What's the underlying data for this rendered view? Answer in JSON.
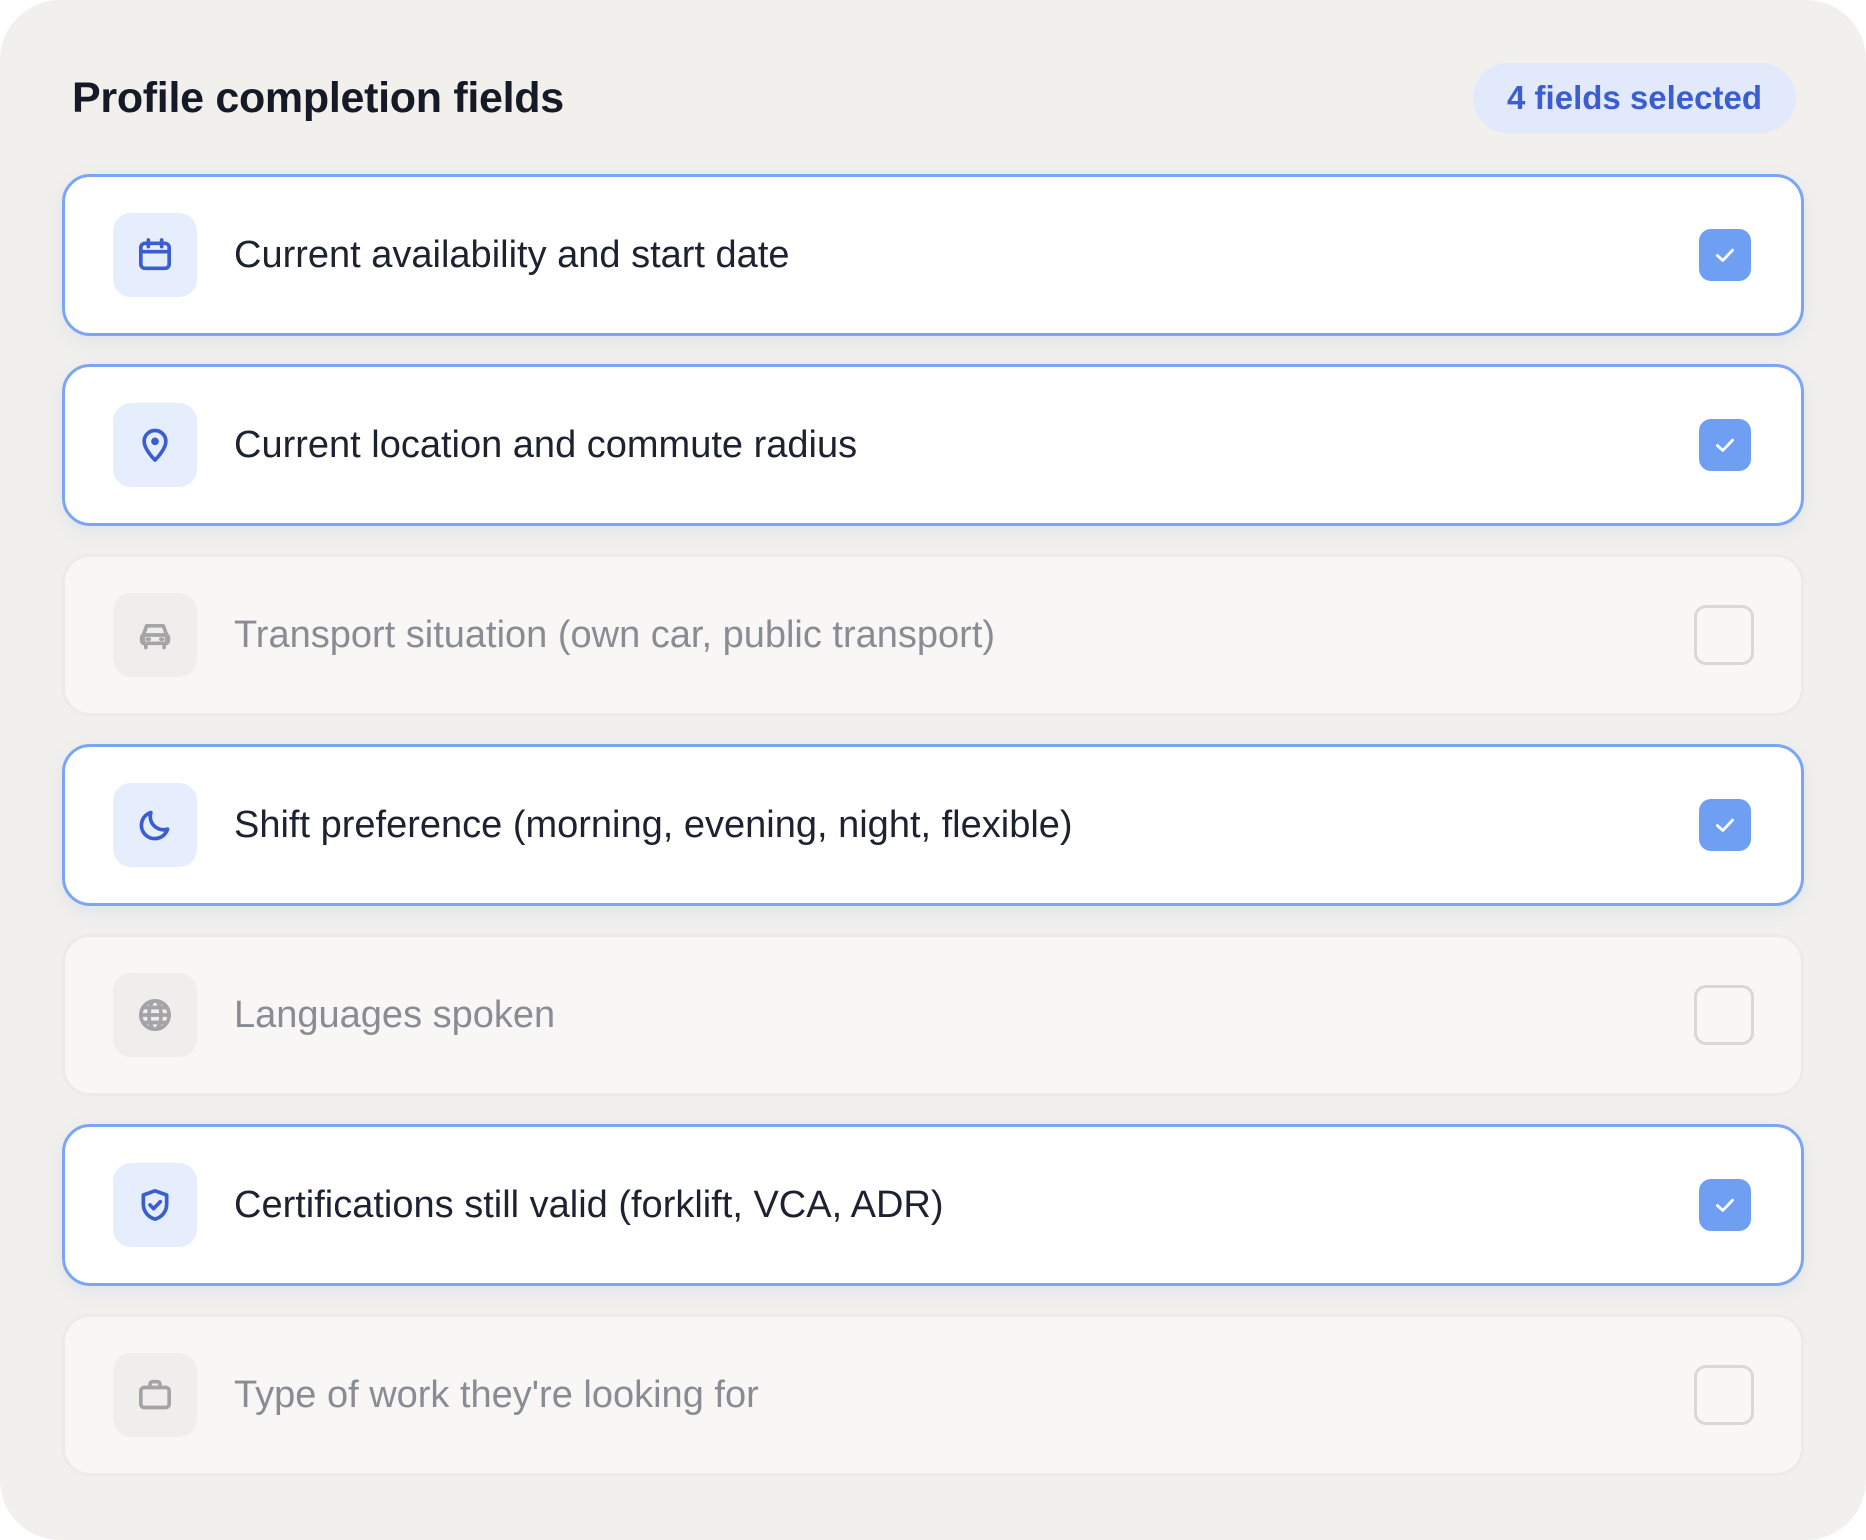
{
  "panel": {
    "title": "Profile completion fields",
    "badge": "4 fields selected"
  },
  "fields": [
    {
      "label": "Current availability and start date",
      "icon": "calendar-icon",
      "checked": true
    },
    {
      "label": "Current location and commute radius",
      "icon": "map-pin-icon",
      "checked": true
    },
    {
      "label": "Transport situation (own car, public transport)",
      "icon": "car-icon",
      "checked": false
    },
    {
      "label": "Shift preference (morning, evening, night, flexible)",
      "icon": "moon-icon",
      "checked": true
    },
    {
      "label": "Languages spoken",
      "icon": "globe-icon",
      "checked": false
    },
    {
      "label": "Certifications still valid (forklift, VCA, ADR)",
      "icon": "shield-check-icon",
      "checked": true
    },
    {
      "label": "Type of work they're looking for",
      "icon": "briefcase-icon",
      "checked": false
    }
  ],
  "colors": {
    "accent": "#3a5ed0",
    "checkbox_checked": "#6f9ff2",
    "selected_border": "#7aa6f5",
    "panel_background": "#f1f0ed"
  }
}
